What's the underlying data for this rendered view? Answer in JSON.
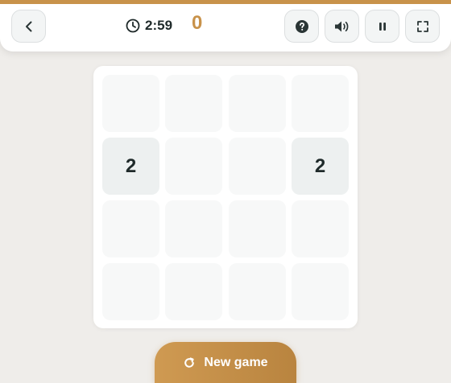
{
  "header": {
    "timer": "2:59",
    "score": "0"
  },
  "board": {
    "tiles": [
      [
        "",
        "",
        "",
        ""
      ],
      [
        "2",
        "",
        "",
        "2"
      ],
      [
        "",
        "",
        "",
        ""
      ],
      [
        "",
        "",
        "",
        ""
      ]
    ]
  },
  "actions": {
    "new_game_label": "New game"
  },
  "colors": {
    "accent": "#c8924a",
    "tile_text": "#1f2a2a"
  }
}
